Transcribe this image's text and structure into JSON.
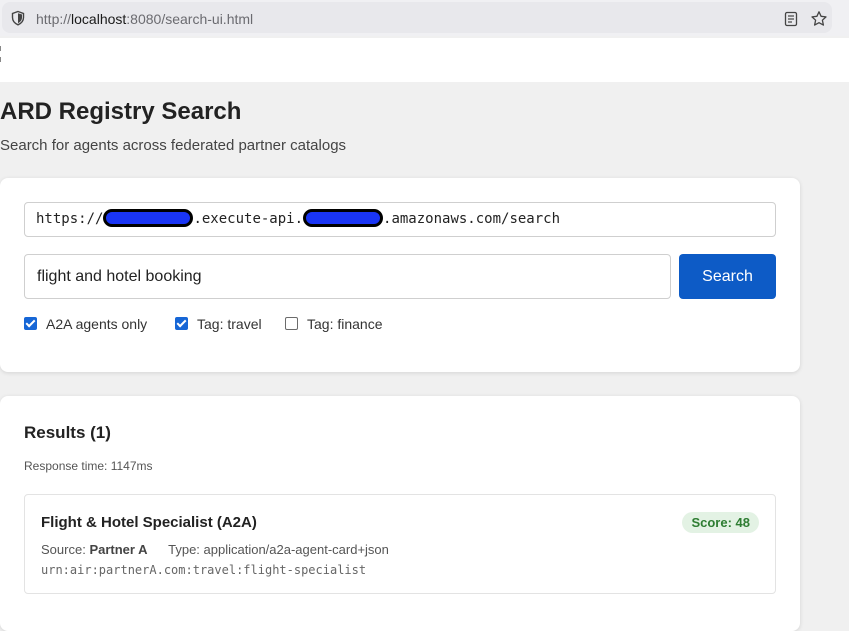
{
  "browser": {
    "url_scheme": "http://",
    "url_host": "localhost",
    "url_rest": ":8080/search-ui.html"
  },
  "page": {
    "title": "ARD Registry Search",
    "subtitle": "Search for agents across federated partner catalogs"
  },
  "search": {
    "endpoint_prefix": "https://",
    "endpoint_mid": ".execute-api.",
    "endpoint_suffix": ".amazonaws.com/search",
    "query": "flight and hotel booking",
    "button_label": "Search",
    "filters": [
      {
        "label": "A2A agents only",
        "checked": true
      },
      {
        "label": "Tag: travel",
        "checked": true
      },
      {
        "label": "Tag: finance",
        "checked": false
      }
    ]
  },
  "results": {
    "title": "Results (1)",
    "response_time": "Response time: 1147ms",
    "items": [
      {
        "name": "Flight & Hotel Specialist (A2A)",
        "score": "Score: 48",
        "source_label": "Source:",
        "source": "Partner A",
        "type": "Type: application/a2a-agent-card+json",
        "urn": "urn:air:partnerA.com:travel:flight-specialist"
      }
    ]
  },
  "colors": {
    "primary": "#0d5bc6",
    "checkbox": "#1666d6",
    "score_bg": "#e3f2e4",
    "score_text": "#2e7d32",
    "redaction": "#1a35f5"
  },
  "icons": [
    "shield-icon",
    "reader-view-icon",
    "bookmark-star-icon"
  ]
}
